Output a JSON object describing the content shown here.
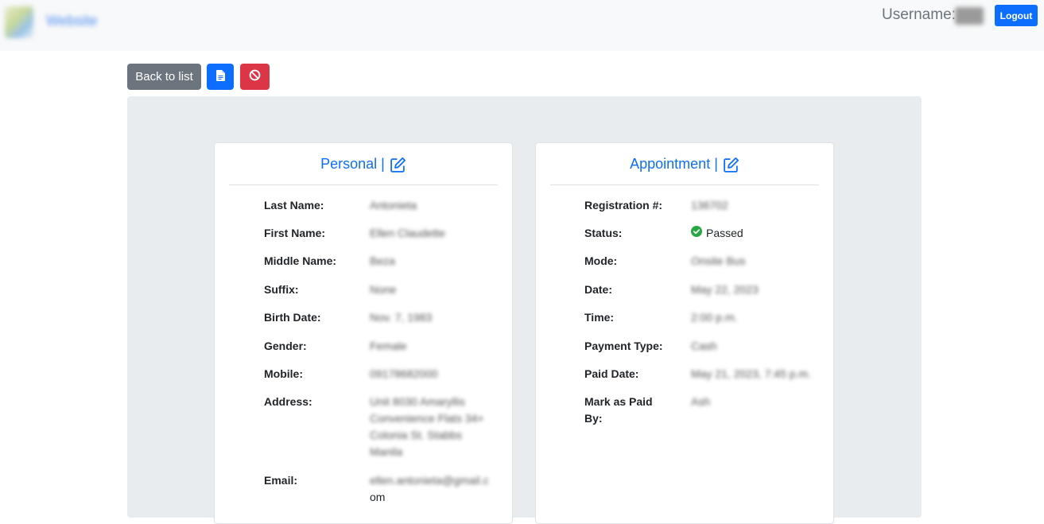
{
  "navbar": {
    "brand": "Website",
    "username_label": "Username:",
    "username_value": "user",
    "logout_label": "Logout"
  },
  "toolbar": {
    "back_label": "Back to list"
  },
  "personal": {
    "title": "Personal |",
    "fields": [
      {
        "label": "Last Name:",
        "value": "Antonieta"
      },
      {
        "label": "First Name:",
        "value": "Ellen Claudette"
      },
      {
        "label": "Middle Name:",
        "value": "Beza"
      },
      {
        "label": "Suffix:",
        "value": "None"
      },
      {
        "label": "Birth Date:",
        "value": "Nov. 7, 1983"
      },
      {
        "label": "Gender:",
        "value": "Female"
      },
      {
        "label": "Mobile:",
        "value": "09178682000"
      },
      {
        "label": "Address:",
        "value_lines": [
          "Unit 8030 Amaryllis",
          "Convenience Flats 34+",
          "Colonia St. Stabbs",
          "Manila"
        ]
      },
      {
        "label": "Email:",
        "value_lines": [
          "ellen.antonieta@gmail.c",
          "om"
        ]
      }
    ]
  },
  "appointment": {
    "title": "Appointment |",
    "fields": [
      {
        "label": "Registration #:",
        "value": "136702"
      },
      {
        "label": "Status:",
        "value": "Passed"
      },
      {
        "label": "Mode:",
        "value": "Onsite Bus"
      },
      {
        "label": "Date:",
        "value": "May 22, 2023"
      },
      {
        "label": "Time:",
        "value": "2:00 p.m."
      },
      {
        "label": "Payment Type:",
        "value": "Cash"
      },
      {
        "label": "Paid Date:",
        "value": "May 21, 2023, 7:45 p.m."
      },
      {
        "label_lines": [
          "Mark as Paid",
          "By:"
        ],
        "value": "Ash"
      }
    ]
  },
  "colors": {
    "primary": "#0d6efd",
    "secondary": "#6c757d",
    "danger": "#dc3545",
    "success": "#28a745",
    "panel": "#e9ecef"
  },
  "icons": {
    "doc_button": "file-icon",
    "cancel_button": "ban-icon",
    "edit": "edit-icon",
    "status": "check-circle-icon"
  }
}
